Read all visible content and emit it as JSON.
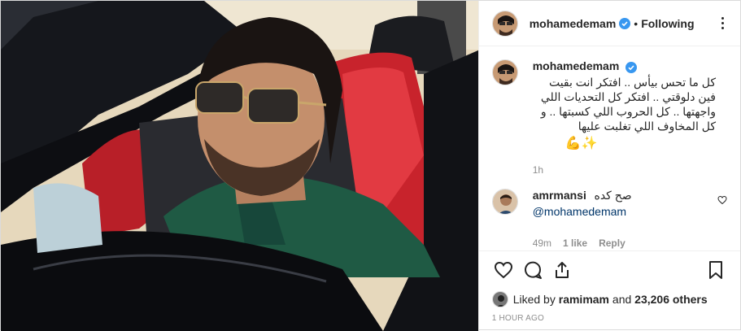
{
  "header": {
    "username": "mohamedemam",
    "separator": "•",
    "follow_state": "Following"
  },
  "caption": {
    "username": "mohamedemam",
    "text": "كل ما تحس بيأس .. افتكر انت بقيت فين دلوقتي .. افتكر كل التحديات اللي واجهتها .. كل الحروب اللي كسبتها .. و كل المخاوف اللي تغلبت عليها",
    "emojis": "💪✨",
    "time": "1h"
  },
  "comment": {
    "username": "amrmansi",
    "text": "صح كده",
    "mention": "@mohamedemam",
    "time": "49m",
    "likes": "1 like",
    "reply": "Reply"
  },
  "likes": {
    "prefix": "Liked by",
    "user": "ramimam",
    "middle": "and",
    "others": "23,206 others"
  },
  "timestamp": "1 HOUR AGO",
  "icons": [
    "verified-badge-icon",
    "more-options-icon",
    "heart-icon",
    "comment-icon",
    "share-icon",
    "bookmark-icon",
    "small-heart-icon"
  ],
  "colors": {
    "verified": "#3897f0",
    "link": "#003569",
    "muted": "#8e8e8e",
    "seat_red": "#c8232c"
  }
}
